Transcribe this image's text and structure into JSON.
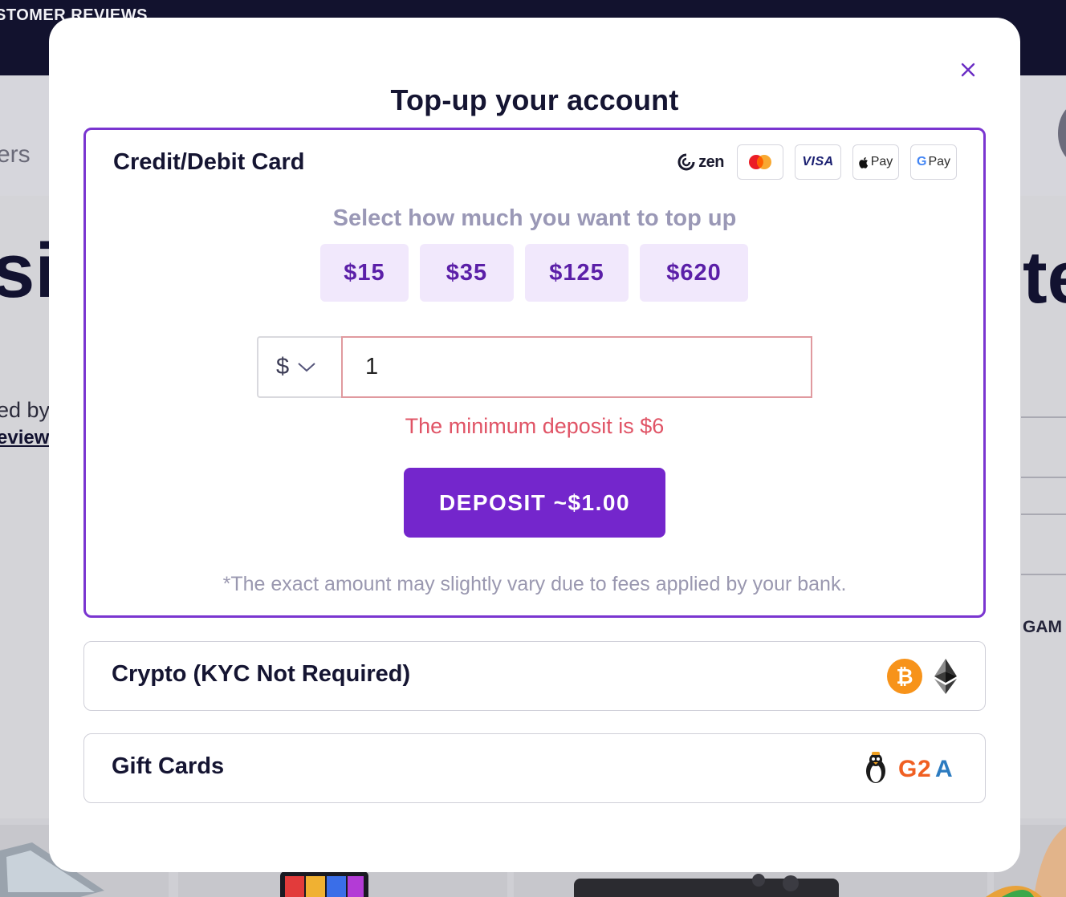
{
  "background": {
    "header_text": "STOMER REVIEWS",
    "left_text_1": "ers",
    "left_big_text": "si",
    "left_text_2": "ed by",
    "left_link": "eview",
    "right_big_text": "te",
    "right_text": "GAM"
  },
  "modal": {
    "title": "Top-up your account",
    "card_panel": {
      "title": "Credit/Debit Card",
      "payment_logos": [
        "zen",
        "mastercard",
        "VISA",
        "Apple Pay",
        "Google Pay"
      ],
      "zen_label": "zen",
      "visa_label": "VISA",
      "apple_pay_label": "Pay",
      "google_pay_g": "G",
      "google_pay_label": "Pay",
      "select_label": "Select how much you want to top up",
      "amount_options": [
        "$15",
        "$35",
        "$125",
        "$620"
      ],
      "currency": "$",
      "amount_value": "1",
      "error": "The minimum deposit is $6",
      "deposit_label": "DEPOSIT ~$1.00",
      "footnote": "*The exact amount may slightly vary due to fees applied by your bank."
    },
    "crypto_panel": {
      "title": "Crypto (KYC Not Required)",
      "icons": [
        "bitcoin-icon",
        "ethereum-icon"
      ]
    },
    "gift_panel": {
      "title": "Gift Cards",
      "icons": [
        "penguin-icon",
        "g2a-logo"
      ],
      "g2a_label": "G2A"
    }
  },
  "colors": {
    "accent": "#7426cc",
    "accent_border": "#7a35d0",
    "amount_bg": "#f1e8fc",
    "amount_text": "#5b1fa8",
    "error": "#e05466",
    "bitcoin": "#f7931a"
  }
}
